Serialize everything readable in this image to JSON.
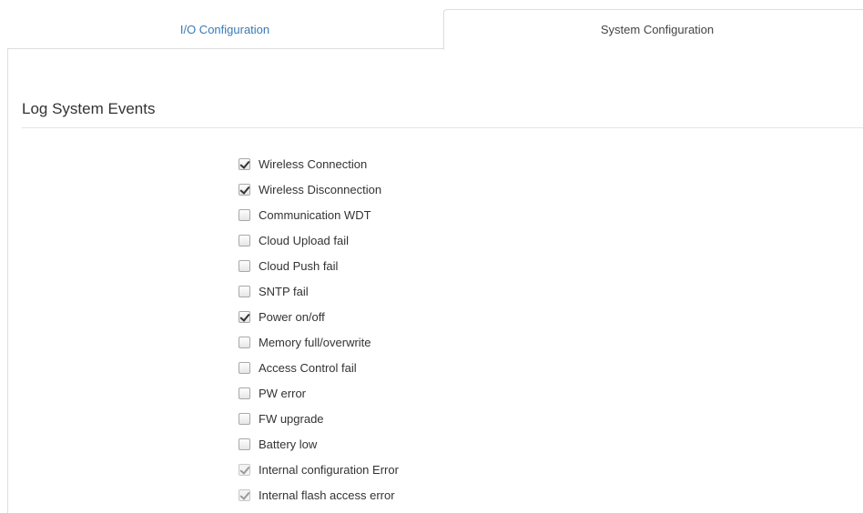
{
  "tabs": [
    {
      "label": "I/O Configuration",
      "active": false
    },
    {
      "label": "System Configuration",
      "active": true
    }
  ],
  "section": {
    "title": "Log System Events"
  },
  "events": [
    {
      "label": "Wireless Connection",
      "checked": true,
      "disabled": false
    },
    {
      "label": "Wireless Disconnection",
      "checked": true,
      "disabled": false
    },
    {
      "label": "Communication WDT",
      "checked": false,
      "disabled": false
    },
    {
      "label": "Cloud Upload fail",
      "checked": false,
      "disabled": false
    },
    {
      "label": "Cloud Push fail",
      "checked": false,
      "disabled": false
    },
    {
      "label": "SNTP fail",
      "checked": false,
      "disabled": false
    },
    {
      "label": "Power on/off",
      "checked": true,
      "disabled": false
    },
    {
      "label": "Memory full/overwrite",
      "checked": false,
      "disabled": false
    },
    {
      "label": "Access Control fail",
      "checked": false,
      "disabled": false
    },
    {
      "label": "PW error",
      "checked": false,
      "disabled": false
    },
    {
      "label": "FW upgrade",
      "checked": false,
      "disabled": false
    },
    {
      "label": "Battery low",
      "checked": false,
      "disabled": false
    },
    {
      "label": "Internal configuration Error",
      "checked": true,
      "disabled": true
    },
    {
      "label": "Internal flash access error",
      "checked": true,
      "disabled": true
    }
  ],
  "colors": {
    "link": "#3a7ab7",
    "border": "#dddddd"
  }
}
